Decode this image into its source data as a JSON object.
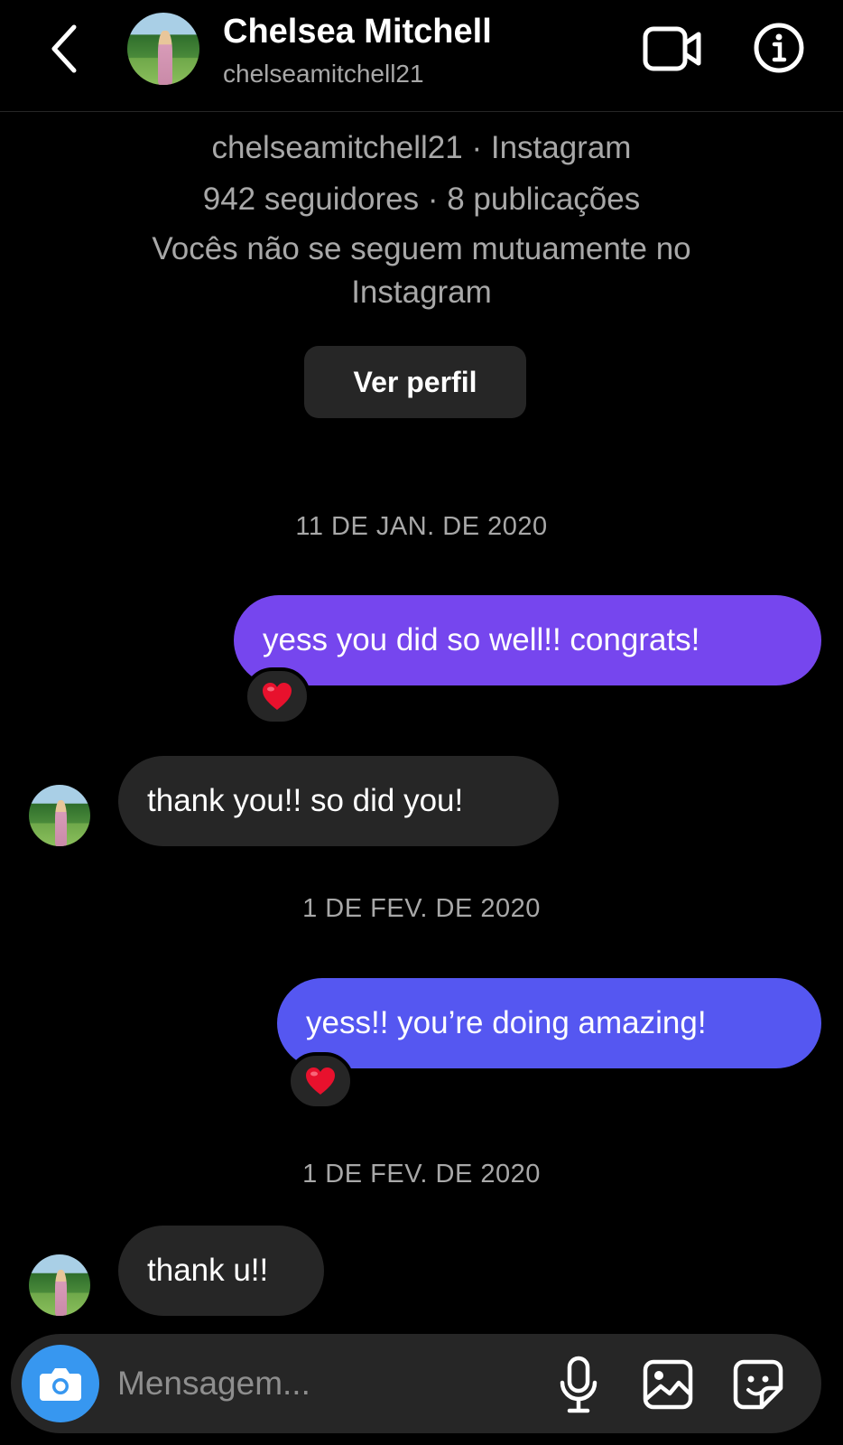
{
  "header": {
    "name": "Chelsea Mitchell",
    "handle": "chelseamitchell21",
    "back_icon": "chevron-left-icon",
    "video_icon": "video-camera-icon",
    "info_icon": "info-icon"
  },
  "profile_summary": {
    "line1": "chelseamitchell21 · Instagram",
    "line2": "942 seguidores · 8 publicações",
    "line3": "Vocês não se seguem mutuamente no Instagram",
    "view_profile_label": "Ver perfil"
  },
  "thread": [
    {
      "type": "date",
      "text": "11 DE JAN. DE 2020"
    },
    {
      "type": "sent",
      "text": "yess you did so well!! congrats!",
      "reaction": "❤️",
      "color": "#7646ee"
    },
    {
      "type": "received",
      "text": "thank you!! so did you!"
    },
    {
      "type": "date",
      "text": "1 DE FEV. DE 2020"
    },
    {
      "type": "sent",
      "text": "yess!! you’re doing amazing!",
      "reaction": "❤️",
      "color": "#5557f1"
    },
    {
      "type": "date",
      "text": "1 DE FEV. DE 2020"
    },
    {
      "type": "received",
      "text": "thank u!!"
    }
  ],
  "composer": {
    "placeholder": "Mensagem...",
    "camera_icon": "camera-icon",
    "mic_icon": "microphone-icon",
    "gallery_icon": "image-gallery-icon",
    "sticker_icon": "sticker-icon"
  },
  "colors": {
    "background": "#000000",
    "received_bubble": "#262626",
    "camera_button": "#3797f0",
    "secondary_text": "#a8a8a8"
  }
}
